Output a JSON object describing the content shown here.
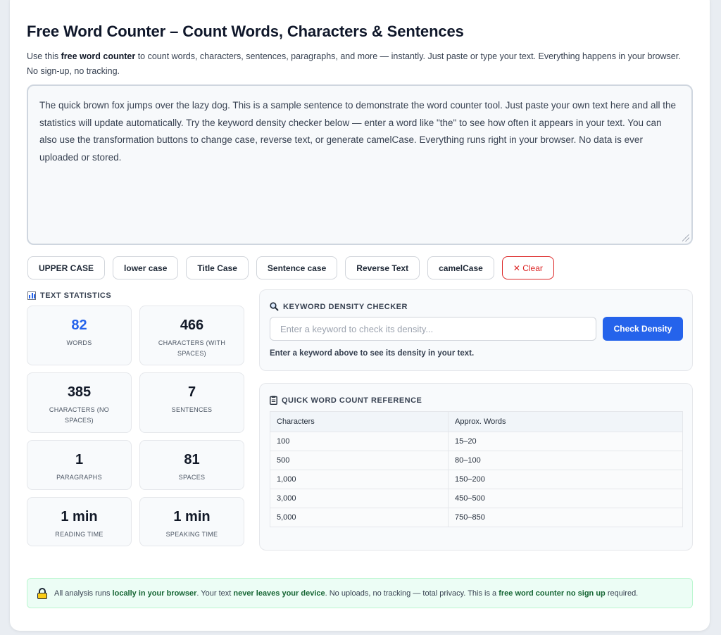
{
  "page": {
    "title": "Free Word Counter – Count Words, Characters & Sentences",
    "intro_before": "Use this ",
    "intro_bold": "free word counter",
    "intro_after": " to count words, characters, sentences, paragraphs, and more — instantly. Just paste or type your text. Everything happens in your browser. No sign-up, no tracking."
  },
  "editor": {
    "text": "The quick brown fox jumps over the lazy dog. This is a sample sentence to demonstrate the word counter tool. Just paste your own text here and all the statistics will update automatically. Try the keyword density checker below — enter a word like \"the\" to see how often it appears in your text. You can also use the transformation buttons to change case, reverse text, or generate camelCase. Everything runs right in your browser. No data is ever uploaded or stored."
  },
  "transform_buttons": {
    "upper": "UPPER CASE",
    "lower": "lower case",
    "title": "Title Case",
    "sentence": "Sentence case",
    "reverse": "Reverse Text",
    "camel": "camelCase",
    "clear": "✕ Clear"
  },
  "stats": {
    "label": "TEXT STATISTICS",
    "words": {
      "value": "82",
      "label": "WORDS"
    },
    "chars_with": {
      "value": "466",
      "label": "CHARACTERS (WITH SPACES)"
    },
    "chars_no": {
      "value": "385",
      "label": "CHARACTERS (NO SPACES)"
    },
    "sentences": {
      "value": "7",
      "label": "SENTENCES"
    },
    "paragraphs": {
      "value": "1",
      "label": "PARAGRAPHS"
    },
    "spaces": {
      "value": "81",
      "label": "SPACES"
    },
    "reading": {
      "value": "1 min",
      "label": "READING TIME"
    },
    "speaking": {
      "value": "1 min",
      "label": "SPEAKING TIME"
    }
  },
  "keyword": {
    "label": "KEYWORD DENSITY CHECKER",
    "placeholder": "Enter a keyword to check its density...",
    "button": "Check Density",
    "hint": "Enter a keyword above to see its density in your text."
  },
  "reference": {
    "label": "QUICK WORD COUNT REFERENCE",
    "headers": [
      "Characters",
      "Approx. Words"
    ],
    "rows": [
      [
        "100",
        "15–20"
      ],
      [
        "500",
        "80–100"
      ],
      [
        "1,000",
        "150–200"
      ],
      [
        "3,000",
        "450–500"
      ],
      [
        "5,000",
        "750–850"
      ]
    ]
  },
  "privacy": {
    "p1": "All analysis runs ",
    "b1": "locally in your browser",
    "p2": ". Your text ",
    "b2": "never leaves your device",
    "p3": ". No uploads, no tracking — total privacy. This is a ",
    "b3": "free word counter no sign up",
    "p4": " required."
  },
  "colors": {
    "accent": "#2563eb",
    "danger": "#dc2626",
    "privacy_bg": "#ecfdf5"
  }
}
